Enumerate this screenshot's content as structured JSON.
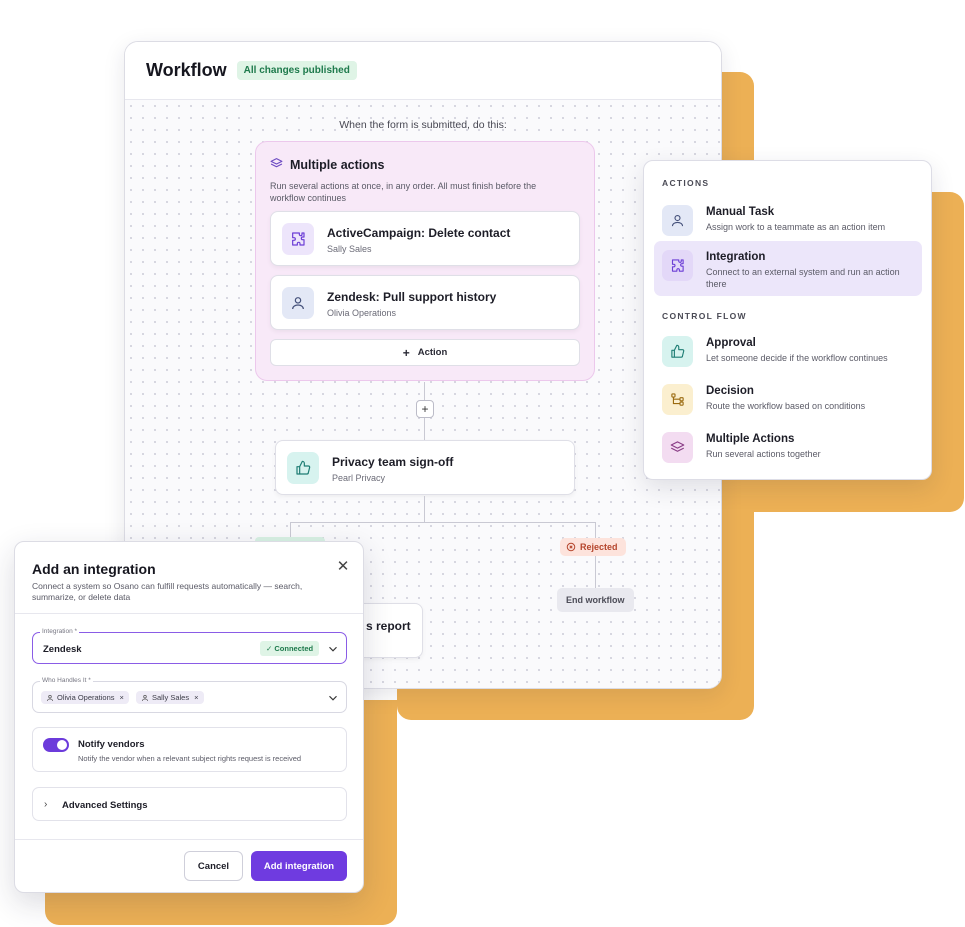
{
  "colors": {
    "accent": "#6f3be0",
    "background_shape": "#ecb055",
    "success_bg": "#dff4e6",
    "success_text": "#1e7a4c",
    "rejected_bg": "#fde3dc",
    "rejected_text": "#b5452c",
    "menu_selected_bg": "#ece6fa"
  },
  "workflow": {
    "title": "Workflow",
    "status_badge": "All changes published",
    "trigger_text": "When the form is submitted, do this:",
    "multiple_actions": {
      "icon": "layers-icon",
      "title": "Multiple actions",
      "description": "Run several actions at once, in any order. All must finish before the workflow continues",
      "actions": [
        {
          "icon": "puzzle-icon",
          "title": "ActiveCampaign: Delete contact",
          "assignee": "Sally Sales"
        },
        {
          "icon": "person-icon",
          "title": "Zendesk: Pull support history",
          "assignee": "Olivia Operations"
        }
      ],
      "add_action_label": "Action"
    },
    "signoff": {
      "icon": "thumbs-up-icon",
      "title": "Privacy team sign-off",
      "assignee": "Pearl Privacy"
    },
    "rejected_label": "Rejected",
    "end_label": "End workflow",
    "partial_card_title": "s report"
  },
  "menu": {
    "sections": [
      {
        "title": "ACTIONS",
        "items": [
          {
            "icon": "person-icon",
            "title": "Manual Task",
            "description": "Assign work to a teammate as an action item",
            "selected": false
          },
          {
            "icon": "puzzle-icon",
            "title": "Integration",
            "description": "Connect to an external system and run an action there",
            "selected": true
          }
        ]
      },
      {
        "title": "CONTROL FLOW",
        "items": [
          {
            "icon": "thumbs-up-icon",
            "title": "Approval",
            "description": "Let someone decide if the workflow continues",
            "selected": false
          },
          {
            "icon": "branch-icon",
            "title": "Decision",
            "description": "Route the workflow based on conditions",
            "selected": false
          },
          {
            "icon": "layers-icon",
            "title": "Multiple Actions",
            "description": "Run several actions together",
            "selected": false
          }
        ]
      }
    ]
  },
  "modal": {
    "title": "Add an integration",
    "description": "Connect a system so Osano can fulfill requests automatically — search, summarize, or delete data",
    "integration_field": {
      "label": "Integration *",
      "value": "Zendesk",
      "status": "Connected"
    },
    "handler_field": {
      "label": "Who Handles It *",
      "chips": [
        "Olivia Operations",
        "Sally Sales"
      ]
    },
    "notify": {
      "title": "Notify vendors",
      "description": "Notify the vendor when a relevant subject rights request is received",
      "enabled": true
    },
    "advanced_label": "Advanced Settings",
    "cancel_label": "Cancel",
    "submit_label": "Add integration"
  }
}
